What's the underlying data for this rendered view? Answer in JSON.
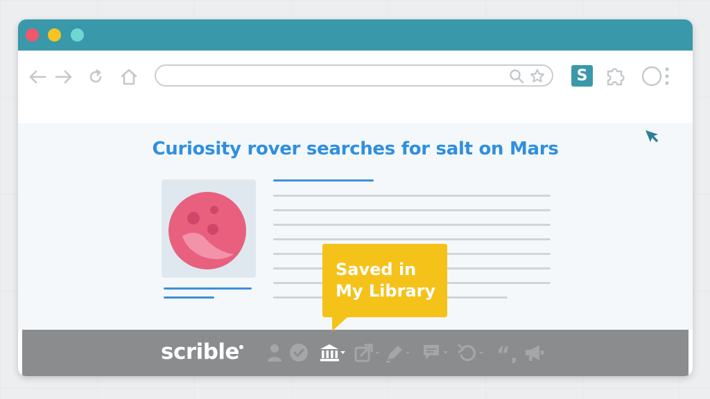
{
  "article": {
    "headline": "Curiosity rover searches for salt on Mars"
  },
  "tooltip": {
    "line1": "Saved in",
    "line2": "My Library"
  },
  "extension": {
    "badge_letter": "S"
  },
  "scrible_toolbar": {
    "brand": "scrible",
    "icons": [
      "user-icon",
      "check-icon",
      "library-icon",
      "share-icon",
      "highlighter-icon",
      "comment-icon",
      "undo-icon",
      "quote-icon",
      "megaphone-icon"
    ]
  },
  "colors": {
    "titlebar": "#3a98ab",
    "accent_blue": "#2f8fe0",
    "tooltip_yellow": "#f5c21a",
    "planet": "#e8607e"
  }
}
